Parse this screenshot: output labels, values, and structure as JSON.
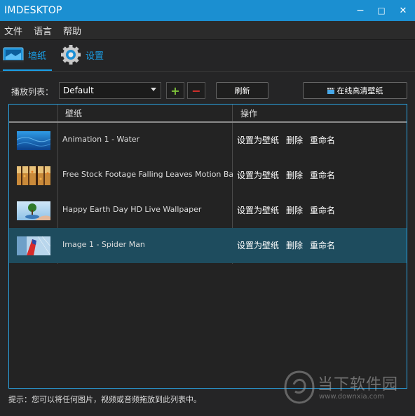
{
  "window": {
    "title": "IMDESKTOP",
    "minimize": "−",
    "maximize": "□",
    "close": "✕"
  },
  "menu": [
    "文件",
    "语言",
    "帮助"
  ],
  "tabs": [
    {
      "label": "墙纸",
      "icon": "wallpaper-icon"
    },
    {
      "label": "设置",
      "icon": "settings-gear-icon"
    }
  ],
  "toolbar": {
    "playlist_label": "播放列表：",
    "playlist_value": "Default",
    "add_label": "+",
    "remove_label": "−",
    "refresh_label": "刷新",
    "online_label": "在线高清壁纸"
  },
  "table": {
    "headers": [
      "壁纸",
      "操作"
    ],
    "rows": [
      {
        "name": "Animation 1 - Water",
        "thumb": "water"
      },
      {
        "name": "Free Stock Footage Falling Leaves Motion Background",
        "thumb": "leaves"
      },
      {
        "name": "Happy Earth Day HD Live Wallpaper",
        "thumb": "earth"
      },
      {
        "name": "Image 1 - Spider Man",
        "thumb": "spiderman",
        "selected": true
      }
    ],
    "actions": [
      "设置为壁纸",
      "删除",
      "重命名"
    ]
  },
  "hint": "提示：您可以将任何图片，视频或音频拖放到此列表中。",
  "watermark": {
    "title": "当下软件园",
    "url": "www.downxia.com"
  },
  "colors": {
    "accent": "#1b8fd1",
    "selected_row": "#1e4c5e",
    "add": "#7ec43a",
    "remove": "#e0302c"
  }
}
